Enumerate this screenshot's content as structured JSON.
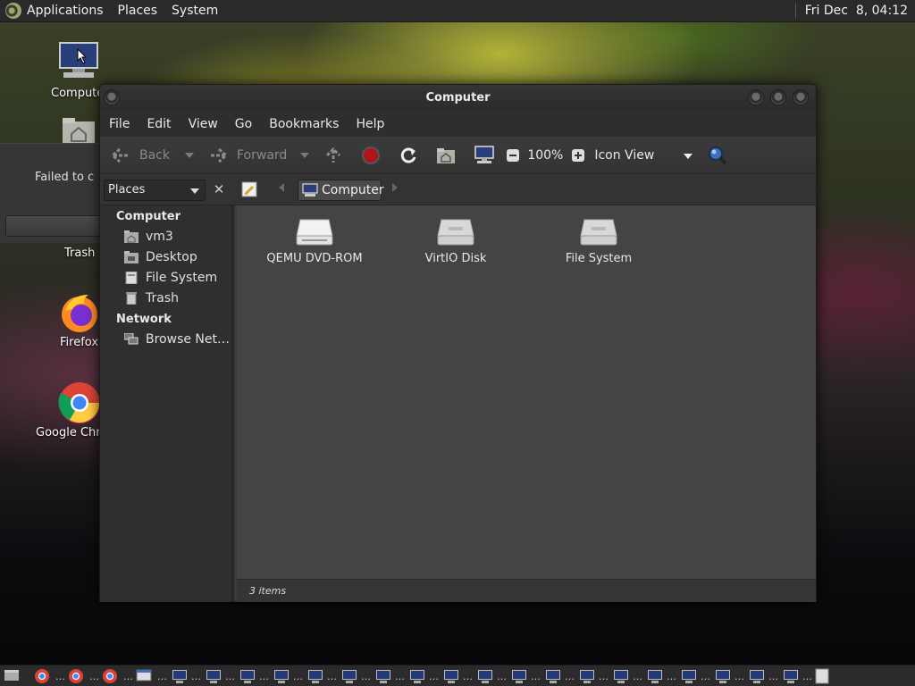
{
  "top_panel": {
    "menus": [
      "Applications",
      "Places",
      "System"
    ],
    "clock": "Fri Dec  8, 04:12"
  },
  "desktop": {
    "icons": [
      {
        "label": "Computer",
        "icon": "computer-icon"
      },
      {
        "label": "",
        "icon": "home-folder-icon"
      },
      {
        "label": "Trash",
        "icon": "trash-icon"
      },
      {
        "label": "Firefox",
        "icon": "firefox-icon"
      },
      {
        "label": "Google Chrome",
        "icon": "chrome-icon"
      }
    ],
    "dialog_text": "Failed to c"
  },
  "window": {
    "title": "Computer",
    "menus": [
      "File",
      "Edit",
      "View",
      "Go",
      "Bookmarks",
      "Help"
    ],
    "toolbar": {
      "back": "Back",
      "forward": "Forward",
      "zoom": "100%",
      "view_mode": "Icon View"
    },
    "location": {
      "places_label": "Places",
      "path_current": "Computer"
    },
    "sidebar": {
      "sections": [
        {
          "heading": "Computer",
          "items": [
            {
              "label": "vm3",
              "icon": "home-folder-icon"
            },
            {
              "label": "Desktop",
              "icon": "desktop-folder-icon"
            },
            {
              "label": "File System",
              "icon": "drive-icon"
            },
            {
              "label": "Trash",
              "icon": "trash-icon"
            }
          ]
        },
        {
          "heading": "Network",
          "items": [
            {
              "label": "Browse Net…",
              "icon": "network-icon"
            }
          ]
        }
      ]
    },
    "files": [
      {
        "label": "QEMU DVD-ROM",
        "icon": "optical-drive-icon"
      },
      {
        "label": "VirtIO Disk",
        "icon": "hard-disk-icon"
      },
      {
        "label": "File System",
        "icon": "hard-disk-icon"
      }
    ],
    "status": "3 items"
  },
  "colors": {
    "panel_bg": "#2a2a2a",
    "window_bg": "#3a3a3a",
    "content_bg": "#444444",
    "stop_red": "#b0141b",
    "search_blue": "#3d6fb8"
  }
}
